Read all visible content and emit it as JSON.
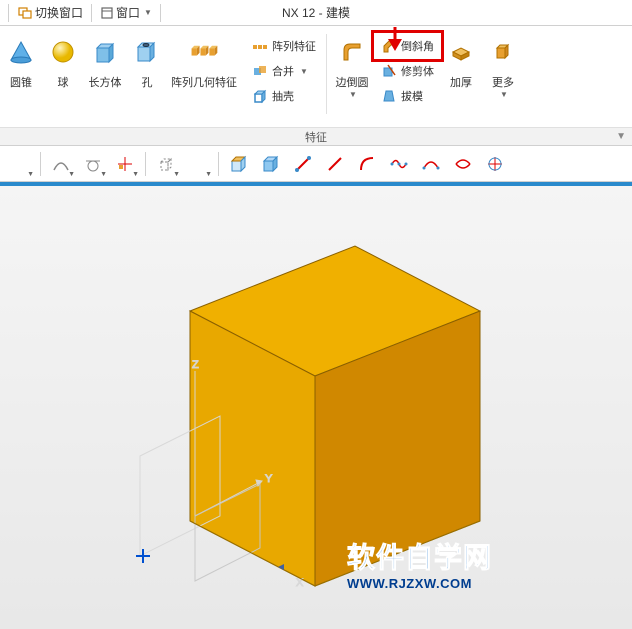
{
  "app_title": "NX 12 - 建模",
  "titlebar": {
    "switch_window": "切换窗口",
    "window_menu": "窗口"
  },
  "ribbon": {
    "group_label": "特征",
    "items": {
      "cone": "圆锥",
      "sphere": "球",
      "block": "长方体",
      "hole": "孔",
      "pattern_geom": "阵列几何特征",
      "pattern_feature": "阵列特征",
      "unite": "合并",
      "shell": "抽壳",
      "edge_blend": "边倒圆",
      "chamfer": "倒斜角",
      "trim_body": "修剪体",
      "draft": "拔模",
      "thicken": "加厚",
      "more": "更多"
    }
  },
  "watermark": {
    "cn": "软件自学网",
    "url": "WWW.RJZXW.COM"
  }
}
